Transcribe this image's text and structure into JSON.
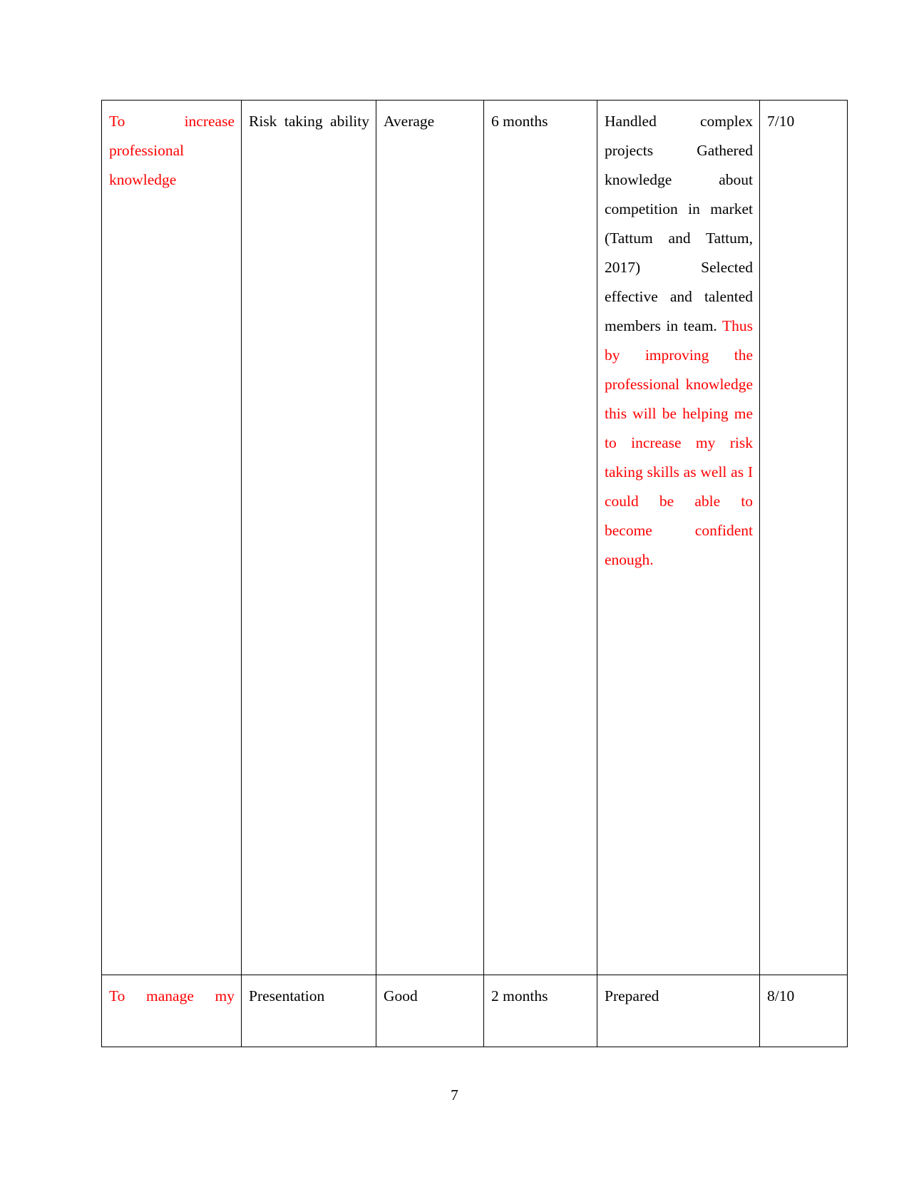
{
  "document": {
    "page_number": "7",
    "colors": {
      "red_text": "#ff0000",
      "black_text": "#000000",
      "table_border": "#000000",
      "page_background": "#ffffff"
    }
  },
  "table": {
    "rows": [
      {
        "goal": "To increase professional knowledge",
        "goal_color": "red",
        "skill": "Risk taking ability",
        "current_level": "Average",
        "time_frame": "6 months",
        "evidence_black": "Handled complex projects Gathered knowledge about competition in market (Tattum and Tattum, 2017) Selected effective and talented members in team.",
        "evidence_red": "Thus by improving the professional knowledge this will be helping me to increase my risk taking skills as well as I could be able to become confident enough.",
        "score": "7/10"
      },
      {
        "goal": "To manage my",
        "goal_color": "red",
        "skill": "Presentation",
        "current_level": "Good",
        "time_frame": "2 months",
        "evidence_black": "Prepared",
        "evidence_red": "",
        "score": "8/10"
      }
    ]
  }
}
